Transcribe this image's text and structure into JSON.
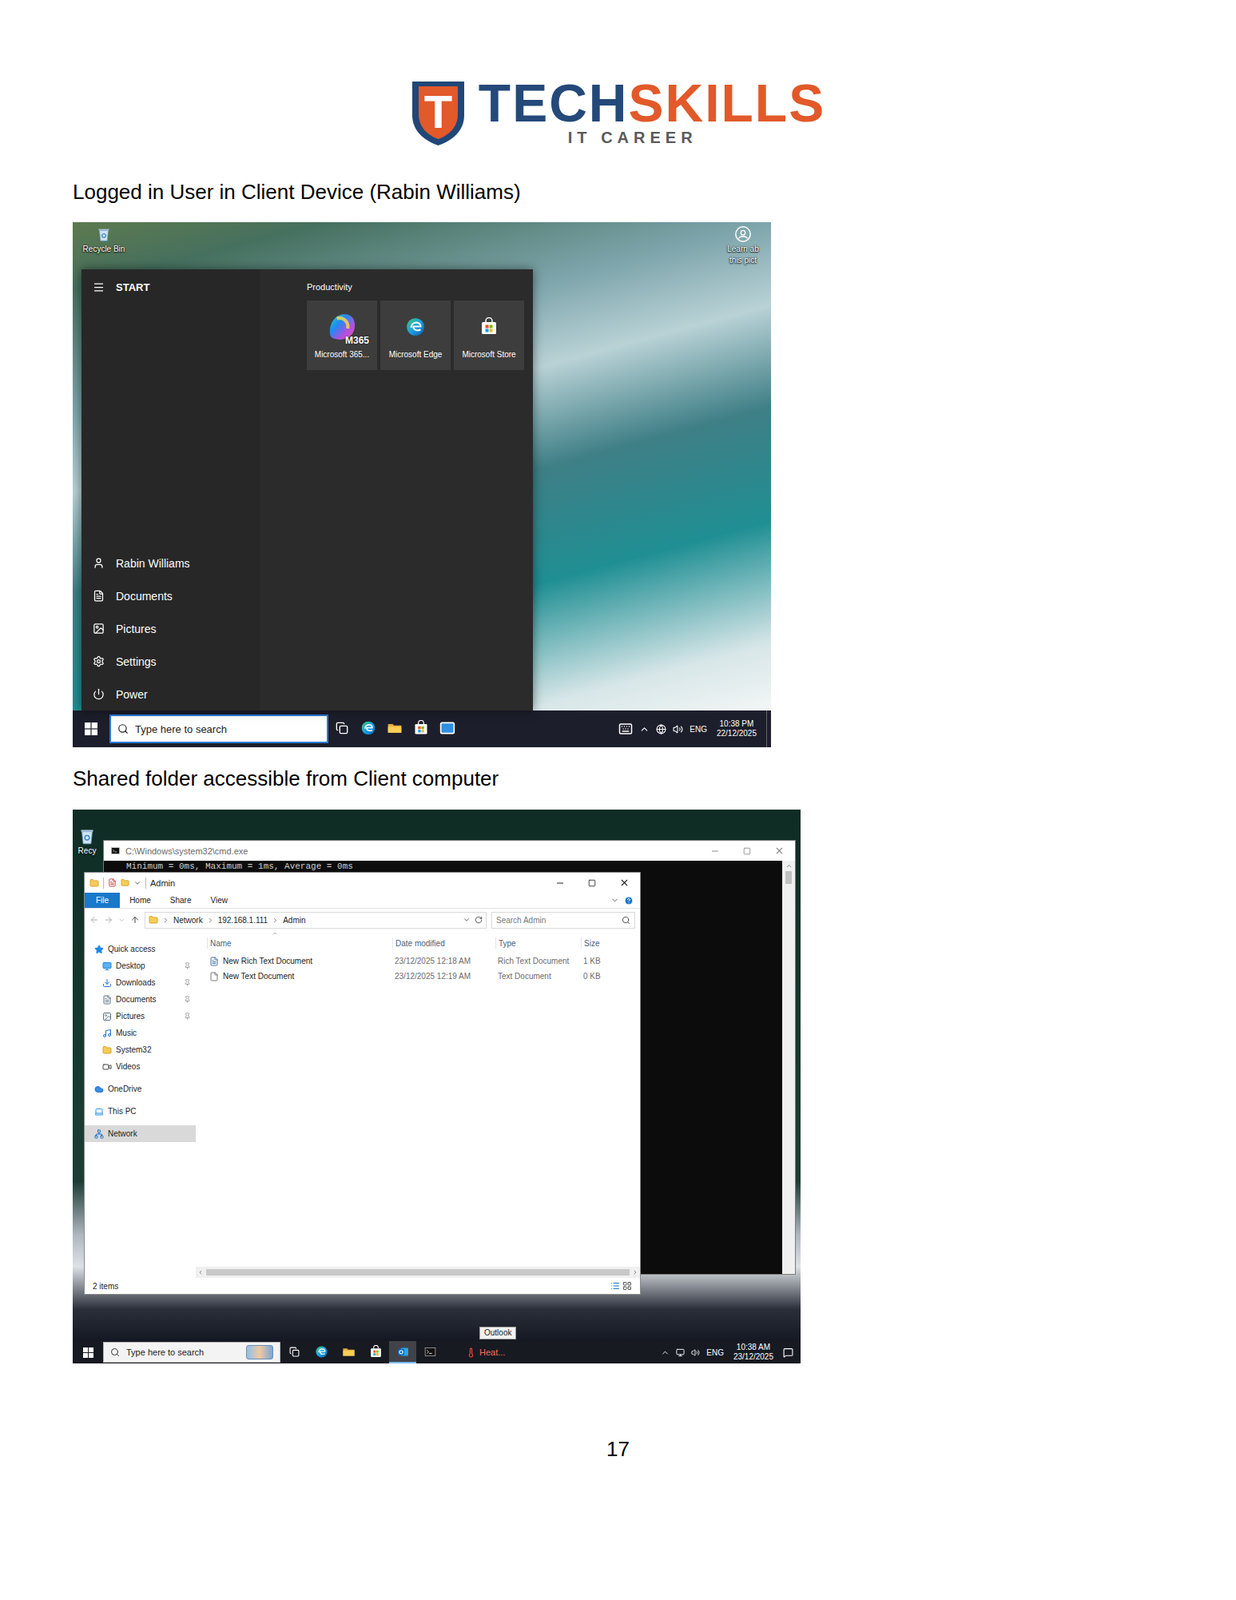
{
  "logo": {
    "mark": "T",
    "brand_primary": "TECH",
    "brand_accent": "SKILLS",
    "tagline": "IT CAREER"
  },
  "caption_1": "Logged in User in Client Device (Rabin Williams)",
  "client_desktop": {
    "recycle_bin": "Recycle Bin",
    "spotlight_label": [
      "Learn ab",
      "this pict"
    ],
    "start_menu": {
      "header": "START",
      "group": "Productivity",
      "tiles": [
        {
          "label": "Microsoft 365...",
          "badge": "M365",
          "kind": "m365"
        },
        {
          "label": "Microsoft Edge",
          "badge": "",
          "kind": "edge"
        },
        {
          "label": "Microsoft Store",
          "badge": "",
          "kind": "store"
        }
      ],
      "items": [
        {
          "label": "Rabin Williams",
          "kind": "user"
        },
        {
          "label": "Documents",
          "kind": "documents"
        },
        {
          "label": "Pictures",
          "kind": "pictures"
        },
        {
          "label": "Settings",
          "kind": "settings"
        },
        {
          "label": "Power",
          "kind": "power"
        }
      ]
    },
    "taskbar": {
      "search_placeholder": "Type here to search",
      "apps": [
        {
          "kind": "taskview",
          "active": false
        },
        {
          "kind": "edge",
          "active": false
        },
        {
          "kind": "explorer",
          "active": false
        },
        {
          "kind": "store",
          "active": false
        },
        {
          "kind": "mail",
          "active": false
        }
      ],
      "language": "ENG",
      "time": "10:38 PM",
      "date": "22/12/2025"
    }
  },
  "caption_2": "Shared folder accessible from Client computer",
  "client_explorer": {
    "desktop_icon": "Recy",
    "console": {
      "title": "C:\\Windows\\system32\\cmd.exe",
      "line": "Minimum = 0ms, Maximum = 1ms, Average = 0ms"
    },
    "explorer": {
      "title": "Admin",
      "ribbon_tabs": [
        {
          "label": "File",
          "kind": "file"
        },
        {
          "label": "Home",
          "kind": "tab"
        },
        {
          "label": "Share",
          "kind": "tab"
        },
        {
          "label": "View",
          "kind": "tab"
        }
      ],
      "breadcrumb": [
        "Network",
        "192.168.1.111",
        "Admin"
      ],
      "search_placeholder": "Search Admin",
      "nav": [
        {
          "label": "Quick access",
          "kind": "quick",
          "pinned": false,
          "selected": false
        },
        {
          "label": "Desktop",
          "kind": "desktop",
          "pinned": true,
          "selected": false
        },
        {
          "label": "Downloads",
          "kind": "downloads",
          "pinned": true,
          "selected": false
        },
        {
          "label": "Documents",
          "kind": "documents",
          "pinned": true,
          "selected": false
        },
        {
          "label": "Pictures",
          "kind": "pictures",
          "pinned": true,
          "selected": false
        },
        {
          "label": "Music",
          "kind": "music",
          "pinned": false,
          "selected": false
        },
        {
          "label": "System32",
          "kind": "folder",
          "pinned": false,
          "selected": false
        },
        {
          "label": "Videos",
          "kind": "videos",
          "pinned": false,
          "selected": false
        },
        {
          "label": "OneDrive",
          "kind": "onedrive",
          "pinned": false,
          "selected": false
        },
        {
          "label": "This PC",
          "kind": "pc",
          "pinned": false,
          "selected": false
        },
        {
          "label": "Network",
          "kind": "network",
          "pinned": false,
          "selected": true
        }
      ],
      "columns": [
        "Name",
        "Date modified",
        "Type",
        "Size"
      ],
      "rows": [
        {
          "name": "New Rich Text Document",
          "modified": "23/12/2025 12:18 AM",
          "type": "Rich Text Document",
          "size": "1 KB",
          "kind": "rtf"
        },
        {
          "name": "New Text Document",
          "modified": "23/12/2025 12:19 AM",
          "type": "Text Document",
          "size": "0 KB",
          "kind": "txt"
        }
      ],
      "status": "2 items"
    },
    "tooltip": "Outlook",
    "taskbar": {
      "search_placeholder": "Type here to search",
      "apps": [
        {
          "kind": "taskview",
          "active": false
        },
        {
          "kind": "edge",
          "active": false
        },
        {
          "kind": "explorer",
          "active": false
        },
        {
          "kind": "store",
          "active": false
        },
        {
          "kind": "outlook",
          "active": true
        },
        {
          "kind": "cmd",
          "active": false
        }
      ],
      "weather": "Heat...",
      "language": "ENG",
      "time": "10:38 AM",
      "date": "23/12/2025"
    }
  },
  "page_number": "17"
}
